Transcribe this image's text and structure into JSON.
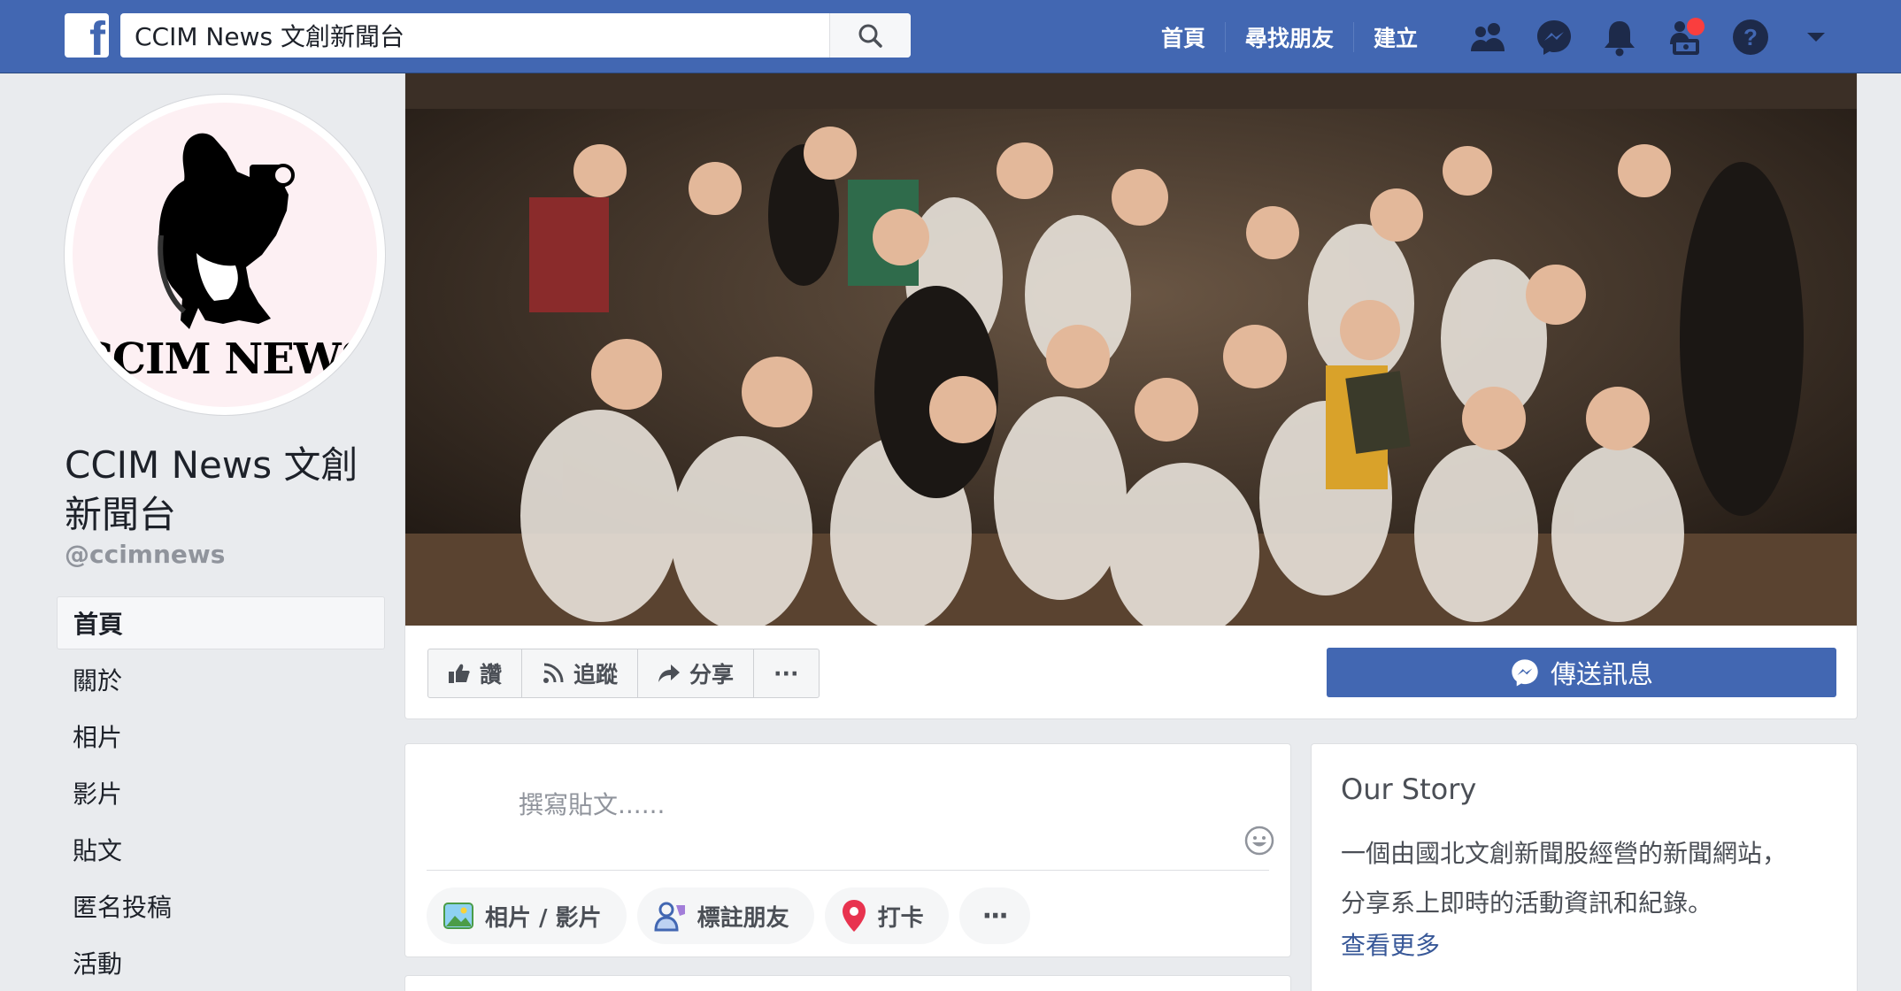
{
  "topbar": {
    "search_value": "CCIM News 文創新聞台",
    "nav": [
      "首頁",
      "尋找朋友",
      "建立"
    ],
    "icons": [
      "friends-icon",
      "messenger-icon",
      "notifications-icon",
      "groups-icon",
      "help-icon",
      "dropdown-icon"
    ]
  },
  "page": {
    "profile_text": "CCIM NEWS",
    "name": "CCIM News 文創新聞台",
    "handle": "@ccimnews"
  },
  "sidebar": {
    "items": [
      {
        "label": "首頁",
        "active": true
      },
      {
        "label": "關於"
      },
      {
        "label": "相片"
      },
      {
        "label": "影片"
      },
      {
        "label": "貼文"
      },
      {
        "label": "匿名投稿"
      },
      {
        "label": "活動"
      }
    ]
  },
  "actions": {
    "like": "讚",
    "follow": "追蹤",
    "share": "分享",
    "more": "···",
    "message": "傳送訊息"
  },
  "composer": {
    "placeholder": "撰寫貼文......",
    "chips": [
      "相片 / 影片",
      "標註朋友",
      "打卡",
      "···"
    ]
  },
  "story": {
    "title": "Our Story",
    "text_line1": "一個由國北文創新聞股經營的新聞網站，",
    "text_line2": "分享系上即時的活動資訊和紀錄。",
    "more": "查看更多"
  },
  "colors": {
    "brand": "#4267b2",
    "background": "#e9ebee",
    "notification": "#fa3e3e"
  }
}
